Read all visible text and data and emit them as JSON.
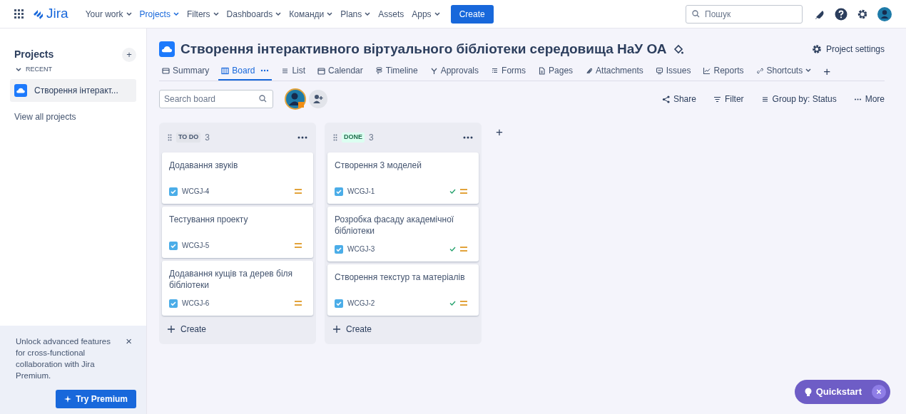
{
  "topbar": {
    "logo": "Jira",
    "items": [
      {
        "label": "Your work",
        "dropdown": true,
        "selected": false
      },
      {
        "label": "Projects",
        "dropdown": true,
        "selected": true
      },
      {
        "label": "Filters",
        "dropdown": true,
        "selected": false
      },
      {
        "label": "Dashboards",
        "dropdown": true,
        "selected": false
      },
      {
        "label": "Команди",
        "dropdown": true,
        "selected": false
      },
      {
        "label": "Plans",
        "dropdown": true,
        "selected": false
      },
      {
        "label": "Assets",
        "dropdown": false,
        "selected": false
      },
      {
        "label": "Apps",
        "dropdown": true,
        "selected": false
      }
    ],
    "create": "Create",
    "search": {
      "placeholder": "Пошук"
    }
  },
  "sidebar": {
    "heading": "Projects",
    "add": "+",
    "section": "RECENT",
    "projects": [
      {
        "name": "Створення інтеракт...",
        "selected": true
      }
    ],
    "view_all": "View all projects",
    "promo": {
      "text": "Unlock advanced features for cross-functional collaboration with Jira Premium.",
      "close": "×",
      "button": "Try Premium"
    }
  },
  "project": {
    "title": "Створення інтерактивного віртуального бібліотеки середовища НаУ ОА",
    "settings": "Project settings",
    "tabs": [
      {
        "label": "Summary",
        "selected": false
      },
      {
        "label": "Board",
        "selected": true
      },
      {
        "label": "List",
        "selected": false
      },
      {
        "label": "Calendar",
        "selected": false
      },
      {
        "label": "Timeline",
        "selected": false
      },
      {
        "label": "Approvals",
        "selected": false
      },
      {
        "label": "Forms",
        "selected": false
      },
      {
        "label": "Pages",
        "selected": false
      },
      {
        "label": "Attachments",
        "selected": false
      },
      {
        "label": "Issues",
        "selected": false
      },
      {
        "label": "Reports",
        "selected": false
      },
      {
        "label": "Shortcuts",
        "selected": false
      }
    ],
    "add_tab": "+"
  },
  "toolbar": {
    "search": {
      "placeholder": "Search board"
    },
    "actions": [
      "Share",
      "Filter",
      "Group by: Status",
      "More"
    ]
  },
  "columns": [
    {
      "name": "TO DO",
      "count": "3",
      "kind": "todo",
      "cards": [
        {
          "title": "Додавання звуків",
          "key": "WCGJ-4",
          "done": false
        },
        {
          "title": "Тестування проекту",
          "key": "WCGJ-5",
          "done": false
        },
        {
          "title": "Додавання кущів та дерев біля бібліотеки",
          "key": "WCGJ-6",
          "done": false
        }
      ],
      "create": "Create"
    },
    {
      "name": "DONE",
      "count": "3",
      "kind": "done",
      "cards": [
        {
          "title": "Створення 3 моделей",
          "key": "WCGJ-1",
          "done": true
        },
        {
          "title": "Розробка фасаду академічної бібліотеки",
          "key": "WCGJ-3",
          "done": true
        },
        {
          "title": "Створення текстур та матеріалів",
          "key": "WCGJ-2",
          "done": true
        }
      ],
      "create": "Create"
    }
  ],
  "add_column": "+",
  "quickstart": {
    "label": "Quickstart",
    "close": "×"
  }
}
